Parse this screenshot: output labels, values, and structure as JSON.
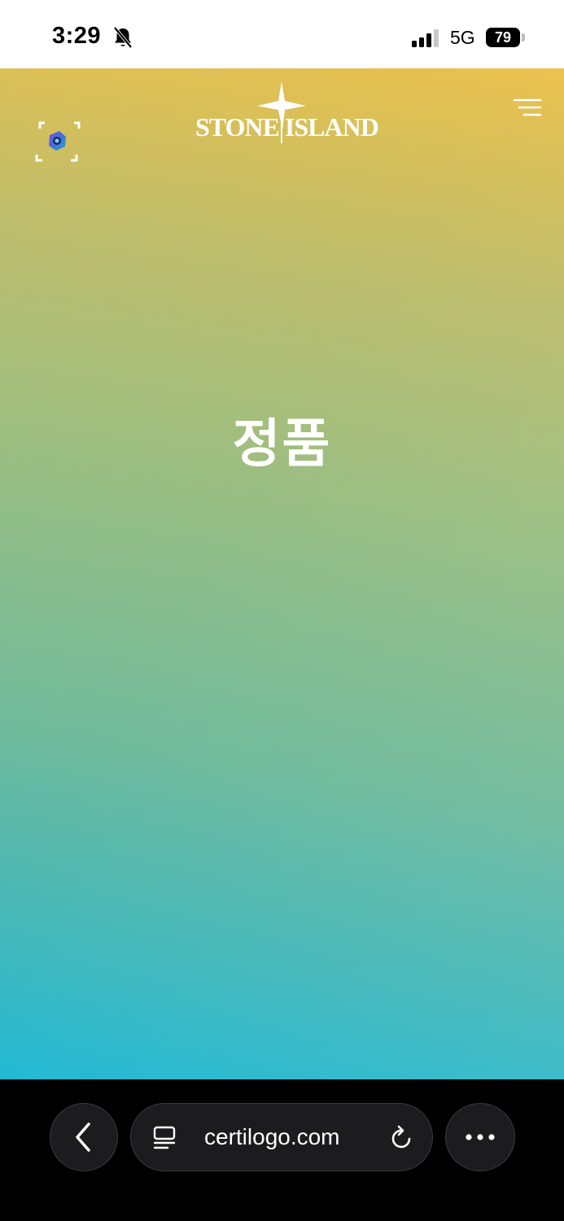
{
  "status_bar": {
    "time": "3:29",
    "network": "5G",
    "battery": "79"
  },
  "header": {
    "brand": "STONE ISLAND"
  },
  "main": {
    "result_text": "정품"
  },
  "browser": {
    "url": "certilogo.com"
  },
  "icons": {
    "bell": "bell-slash-icon",
    "scanner": "scan-icon",
    "menu": "menu-icon",
    "back": "chevron-left-icon",
    "page": "page-menu-icon",
    "reload": "reload-icon",
    "more": "more-icon"
  },
  "colors": {
    "gradient_top": "#ebc14c",
    "gradient_bottom": "#20b8d4",
    "toolbar_bg": "#000000"
  }
}
